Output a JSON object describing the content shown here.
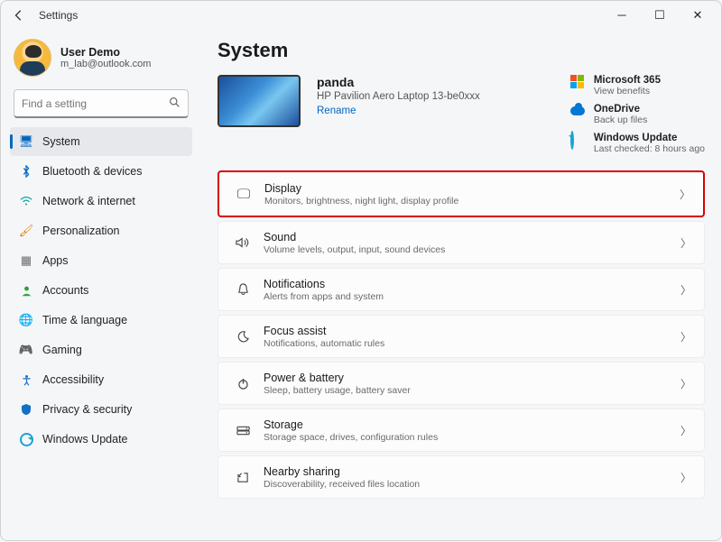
{
  "window": {
    "title": "Settings"
  },
  "user": {
    "name": "User Demo",
    "email": "m_lab@outlook.com"
  },
  "search": {
    "placeholder": "Find a setting"
  },
  "sidebar": {
    "items": [
      {
        "label": "System",
        "icon": "display-icon",
        "active": true
      },
      {
        "label": "Bluetooth & devices",
        "icon": "bluetooth-icon"
      },
      {
        "label": "Network & internet",
        "icon": "wifi-icon"
      },
      {
        "label": "Personalization",
        "icon": "brush-icon"
      },
      {
        "label": "Apps",
        "icon": "apps-icon"
      },
      {
        "label": "Accounts",
        "icon": "person-icon"
      },
      {
        "label": "Time & language",
        "icon": "globe-clock-icon"
      },
      {
        "label": "Gaming",
        "icon": "gamepad-icon"
      },
      {
        "label": "Accessibility",
        "icon": "accessibility-icon"
      },
      {
        "label": "Privacy & security",
        "icon": "shield-icon"
      },
      {
        "label": "Windows Update",
        "icon": "update-icon"
      }
    ]
  },
  "page": {
    "title": "System",
    "device": {
      "name": "panda",
      "model": "HP Pavilion Aero Laptop 13-be0xxx",
      "rename": "Rename"
    },
    "promos": {
      "m365": {
        "title": "Microsoft 365",
        "sub": "View benefits"
      },
      "onedrive": {
        "title": "OneDrive",
        "sub": "Back up files"
      },
      "wu": {
        "title": "Windows Update",
        "sub": "Last checked: 8 hours ago"
      }
    },
    "rows": [
      {
        "title": "Display",
        "sub": "Monitors, brightness, night light, display profile",
        "icon": "monitor-icon",
        "highlight": true
      },
      {
        "title": "Sound",
        "sub": "Volume levels, output, input, sound devices",
        "icon": "speaker-icon"
      },
      {
        "title": "Notifications",
        "sub": "Alerts from apps and system",
        "icon": "bell-icon"
      },
      {
        "title": "Focus assist",
        "sub": "Notifications, automatic rules",
        "icon": "moon-icon"
      },
      {
        "title": "Power & battery",
        "sub": "Sleep, battery usage, battery saver",
        "icon": "power-icon"
      },
      {
        "title": "Storage",
        "sub": "Storage space, drives, configuration rules",
        "icon": "storage-icon"
      },
      {
        "title": "Nearby sharing",
        "sub": "Discoverability, received files location",
        "icon": "share-icon"
      }
    ]
  }
}
